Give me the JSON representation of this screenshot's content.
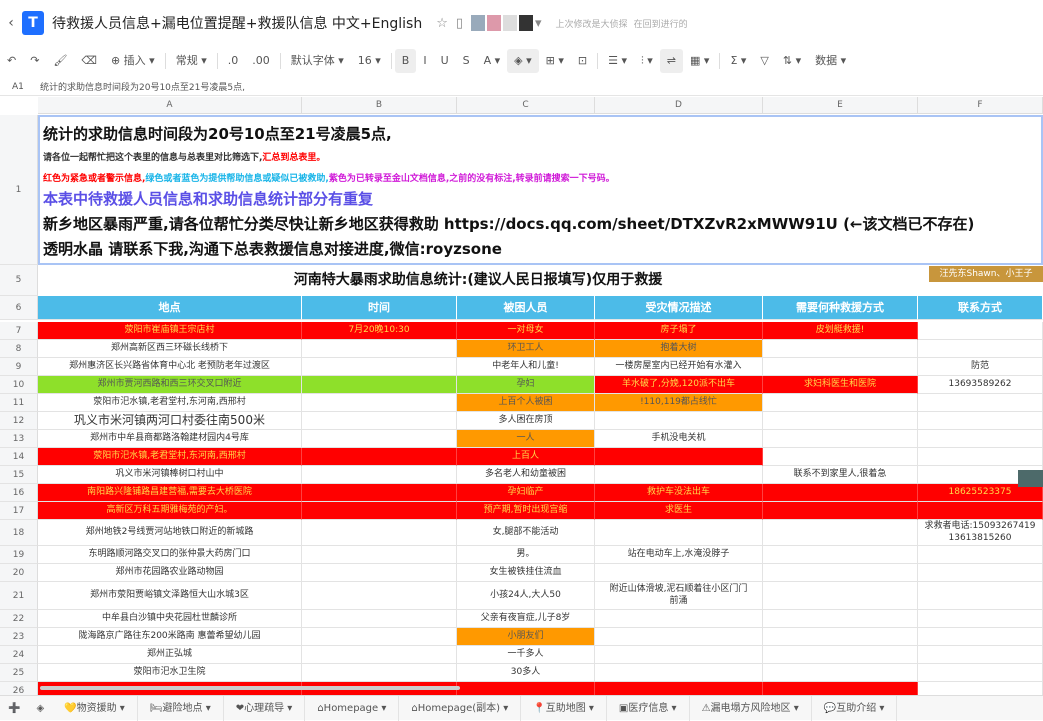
{
  "app": {
    "title": "待救援人员信息+漏电位置提醒+救援队信息 中文+English",
    "status1": "上次修改是大侦探",
    "status2": "在回到进行的",
    "back_icon": "chevron-left-icon",
    "star_icon": "star-icon",
    "doc_icon": "file-icon"
  },
  "toolbar": {
    "items": [
      "↶",
      "↷",
      "🖌",
      "⌫",
      "⊕ 插入 ▾",
      "常规 ▾",
      ".0",
      ".00",
      "默认字体 ▾",
      "16 ▾",
      "B",
      "I",
      "U",
      "S",
      "A ▾",
      "◈ ▾",
      "⊞ ▾",
      "⊡",
      "☰ ▾",
      "⫶ ▾",
      "⇌",
      "▦ ▾",
      "Σ ▾",
      "▽",
      "⇅ ▾",
      "数据 ▾"
    ]
  },
  "formula": {
    "ref": "A1",
    "value": "统计的求助信息时间段为20号10点至21号凌晨5点,"
  },
  "columns": [
    "A",
    "B",
    "C",
    "D",
    "E",
    "F"
  ],
  "row1": {
    "l1": "统计的求助信息时间段为20号10点至21号凌晨5点,",
    "l2a": "请各位一起帮忙把这个表里的信息与总表里对比筛选下,",
    "l2b": "汇总到总表里。",
    "l3a": "红色为紧急或者警示信息,",
    "l3b": "绿色或者蓝色为提供帮助信息或疑似已被救助,",
    "l3c": "紫色为已转录至金山文档信息,之前的没有标注,转录前请搜索一下号码。",
    "l4": "本表中待救援人员信息和求助信息统计部分有重复",
    "l5": "新乡地区暴雨严重,请各位帮忙分类尽快让新乡地区获得救助 https://docs.qq.com/sheet/DTXZvR2xMWW91U   (←该文档已不存在)",
    "l6": "透明水晶 请联系下我,沟通下总表救援信息对接进度,微信:royzsone"
  },
  "row5": {
    "title": "河南特大暴雨求助信息统计:(建议人民日报填写)仅用于救援",
    "tag": "汪先东Shawn、小王子"
  },
  "headers": [
    "地点",
    "时间",
    "被困人员",
    "受灾情况描述",
    "需要何种救援方式",
    "联系方式"
  ],
  "colors": {
    "red": "#ff0000",
    "orange": "#ff9900",
    "green": "#8ee02a",
    "header": "#4cbbe8",
    "alert_text": "#ffd84a"
  },
  "rows": [
    {
      "n": "7",
      "cells": [
        [
          "荥阳市崔庙镇王宗店村",
          "r"
        ],
        [
          "7月20晚10:30",
          "r"
        ],
        [
          "一对母女",
          "r"
        ],
        [
          "房子塌了",
          "r"
        ],
        [
          "皮划艇救援!",
          "r"
        ],
        [
          "",
          ""
        ]
      ]
    },
    {
      "n": "8",
      "cells": [
        [
          "郑州高新区西三环磁长线桥下",
          ""
        ],
        [
          "",
          ""
        ],
        [
          "环卫工人",
          "o"
        ],
        [
          "抱着大树",
          "o"
        ],
        [
          "",
          ""
        ],
        [
          "",
          ""
        ]
      ]
    },
    {
      "n": "9",
      "cells": [
        [
          "郑州惠济区长兴路省体育中心北 老预防老年过渡区",
          ""
        ],
        [
          "",
          ""
        ],
        [
          "中老年人和儿童!",
          ""
        ],
        [
          "一楼房屋室内已经开始有水灌入",
          ""
        ],
        [
          "",
          ""
        ],
        [
          "防范",
          ""
        ]
      ]
    },
    {
      "n": "10",
      "cells": [
        [
          "郑州市贾河西路和西三环交叉口附近",
          "g"
        ],
        [
          "",
          "g"
        ],
        [
          "孕妇",
          "g"
        ],
        [
          "羊水破了,分娩,120派不出车",
          "r"
        ],
        [
          "求妇科医生和医院",
          "r"
        ],
        [
          "13693589262",
          ""
        ]
      ]
    },
    {
      "n": "11",
      "cells": [
        [
          "荥阳市汜水镇,老君堂村,东河南,西邢村",
          ""
        ],
        [
          "",
          ""
        ],
        [
          "上百个人被困",
          "o"
        ],
        [
          "!110,119都占线忙",
          "o"
        ],
        [
          "",
          ""
        ],
        [
          "",
          ""
        ]
      ]
    },
    {
      "n": "12",
      "cells": [
        [
          "巩义市米河镇两河口村委往南500米",
          ""
        ],
        [
          "",
          ""
        ],
        [
          "多人困在房顶",
          ""
        ],
        [
          "",
          ""
        ],
        [
          "",
          ""
        ],
        [
          "",
          ""
        ]
      ]
    },
    {
      "n": "13",
      "cells": [
        [
          "郑州市中牟县商都路洛翰建材园内4号库",
          ""
        ],
        [
          "",
          ""
        ],
        [
          "一人",
          "o"
        ],
        [
          "手机没电关机",
          ""
        ],
        [
          "",
          ""
        ],
        [
          "",
          ""
        ]
      ]
    },
    {
      "n": "14",
      "cells": [
        [
          "荥阳市汜水镇,老君堂村,东河南,西邢村",
          "r"
        ],
        [
          "",
          "r"
        ],
        [
          "上百人",
          "r"
        ],
        [
          "",
          "r"
        ],
        [
          "",
          ""
        ],
        [
          "",
          ""
        ]
      ]
    },
    {
      "n": "15",
      "cells": [
        [
          "巩义市米河镇棒树口村山中",
          ""
        ],
        [
          "",
          ""
        ],
        [
          "多名老人和幼童被困",
          ""
        ],
        [
          "",
          ""
        ],
        [
          "联系不到家里人,很着急",
          ""
        ],
        [
          "",
          ""
        ]
      ]
    },
    {
      "n": "16",
      "cells": [
        [
          "南阳路兴隆铺路昌建营福,需要去大桥医院",
          "r"
        ],
        [
          "",
          "r"
        ],
        [
          "孕妇临产",
          "r"
        ],
        [
          "救护车没法出车",
          "r"
        ],
        [
          "",
          "r"
        ],
        [
          "18625523375",
          "r"
        ]
      ]
    },
    {
      "n": "17",
      "cells": [
        [
          "高新区万科五期雅梅苑的产妇。",
          "r"
        ],
        [
          "",
          "r"
        ],
        [
          "预产期,暂时出现宫缩",
          "r"
        ],
        [
          "求医生",
          "r"
        ],
        [
          "",
          "r"
        ],
        [
          "",
          "r"
        ]
      ]
    },
    {
      "n": "18",
      "cells": [
        [
          "郑州地铁2号线贾河站地铁口附近的新城路",
          ""
        ],
        [
          "",
          ""
        ],
        [
          "女,腿部不能活动",
          ""
        ],
        [
          "",
          ""
        ],
        [
          "",
          ""
        ],
        [
          "求救者电话:15093267419\n13613815260",
          ""
        ]
      ]
    },
    {
      "n": "19",
      "cells": [
        [
          "东明路顺河路交叉口的张仲景大药房门口",
          ""
        ],
        [
          "",
          ""
        ],
        [
          "男。",
          ""
        ],
        [
          "站在电动车上,水淹没脖子",
          ""
        ],
        [
          "",
          ""
        ],
        [
          "",
          ""
        ]
      ]
    },
    {
      "n": "20",
      "cells": [
        [
          "郑州市花园路农业路动物园",
          ""
        ],
        [
          "",
          ""
        ],
        [
          "女生被铁挂住流血",
          ""
        ],
        [
          "",
          ""
        ],
        [
          "",
          ""
        ],
        [
          "",
          ""
        ]
      ]
    },
    {
      "n": "21",
      "cells": [
        [
          "郑州市荥阳贾峪镇文泽路恒大山水城3区",
          ""
        ],
        [
          "",
          ""
        ],
        [
          "小孩24人,大人50",
          ""
        ],
        [
          "附近山体滑坡,泥石顺着往小区门门\n前涌",
          ""
        ],
        [
          "",
          ""
        ],
        [
          "",
          ""
        ]
      ]
    },
    {
      "n": "22",
      "cells": [
        [
          "中牟县白沙镇中央花园杜世麟诊所",
          ""
        ],
        [
          "",
          ""
        ],
        [
          "父亲有夜盲症,儿子8岁",
          ""
        ],
        [
          "",
          ""
        ],
        [
          "",
          ""
        ],
        [
          "",
          ""
        ]
      ]
    },
    {
      "n": "23",
      "cells": [
        [
          "陇海路京广路往东200米路南 惠蕾希望幼儿园",
          ""
        ],
        [
          "",
          ""
        ],
        [
          "小朋友们",
          "o"
        ],
        [
          "",
          ""
        ],
        [
          "",
          ""
        ],
        [
          "",
          ""
        ]
      ]
    },
    {
      "n": "24",
      "cells": [
        [
          "郑州正弘城",
          ""
        ],
        [
          "",
          ""
        ],
        [
          "一千多人",
          ""
        ],
        [
          "",
          ""
        ],
        [
          "",
          ""
        ],
        [
          "",
          ""
        ]
      ]
    },
    {
      "n": "25",
      "cells": [
        [
          "荥阳市汜水卫生院",
          ""
        ],
        [
          "",
          ""
        ],
        [
          "30多人",
          ""
        ],
        [
          "",
          ""
        ],
        [
          "",
          ""
        ],
        [
          "",
          ""
        ]
      ]
    },
    {
      "n": "26",
      "cells": [
        [
          "",
          "r"
        ],
        [
          "",
          "r"
        ],
        [
          "",
          "r"
        ],
        [
          "",
          "r"
        ],
        [
          "",
          "r"
        ],
        [
          "",
          ""
        ]
      ]
    }
  ],
  "tabs": [
    {
      "icon": "➕",
      "label": ""
    },
    {
      "icon": "◈",
      "label": ""
    },
    {
      "icon": "💛",
      "label": "物资援助 ▾"
    },
    {
      "icon": "🛏",
      "label": "避险地点 ▾"
    },
    {
      "icon": "❤",
      "label": "心理疏导 ▾"
    },
    {
      "icon": "⌂",
      "label": "Homepage ▾"
    },
    {
      "icon": "⌂",
      "label": "Homepage(副本) ▾"
    },
    {
      "icon": "📍",
      "label": "互助地图 ▾"
    },
    {
      "icon": "▣",
      "label": "医疗信息 ▾"
    },
    {
      "icon": "⚠",
      "label": "漏电塌方风险地区 ▾"
    },
    {
      "icon": "💬",
      "label": "互助介绍 ▾"
    }
  ]
}
